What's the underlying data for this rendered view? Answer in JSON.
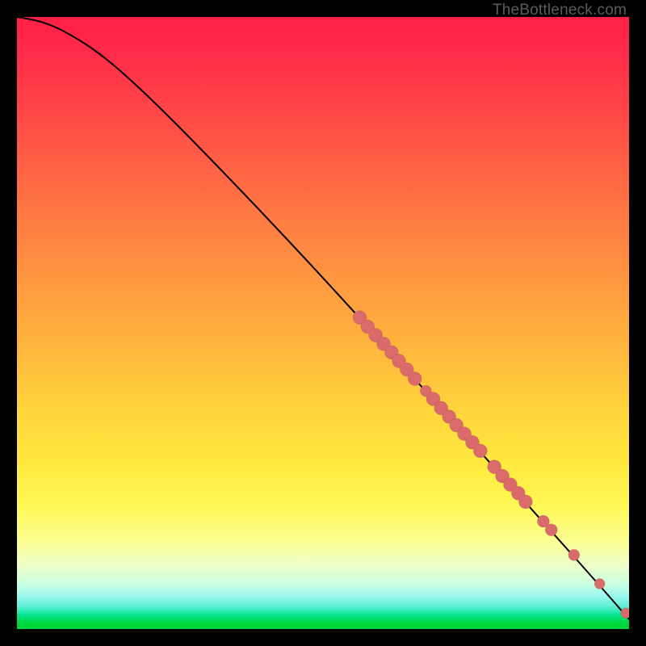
{
  "watermark": "TheBottleneck.com",
  "chart_data": {
    "type": "line",
    "title": "",
    "xlabel": "",
    "ylabel": "",
    "xlim": [
      0,
      100
    ],
    "ylim": [
      0,
      100
    ],
    "grid": false,
    "legend": false,
    "background_gradient": {
      "stops": [
        {
          "pos": 0.0,
          "color": "#ff1f45"
        },
        {
          "pos": 0.14,
          "color": "#ff4247"
        },
        {
          "pos": 0.31,
          "color": "#ff7543"
        },
        {
          "pos": 0.49,
          "color": "#ffa83f"
        },
        {
          "pos": 0.66,
          "color": "#ffd93c"
        },
        {
          "pos": 0.8,
          "color": "#fff856"
        },
        {
          "pos": 0.9,
          "color": "#eeffc8"
        },
        {
          "pos": 0.96,
          "color": "#5ef0d8"
        },
        {
          "pos": 1.0,
          "color": "#00d438"
        }
      ]
    },
    "series": [
      {
        "name": "curve",
        "kind": "line",
        "x": [
          0,
          4,
          8,
          14,
          22,
          34,
          48,
          62,
          76,
          88,
          96,
          100
        ],
        "y": [
          100,
          99.3,
          97.6,
          93.8,
          86.6,
          74.4,
          59.6,
          44.2,
          28.6,
          15.2,
          6.2,
          1.6
        ]
      },
      {
        "name": "points",
        "kind": "scatter",
        "x": [
          56,
          57.3,
          58.6,
          59.9,
          61.2,
          62.4,
          63.7,
          65.0,
          66.8,
          68.0,
          69.3,
          70.6,
          71.8,
          73.1,
          74.4,
          75.7,
          78.0,
          79.3,
          80.6,
          81.9,
          83.1,
          86.0,
          87.3,
          91.0,
          95.2,
          99.5
        ],
        "y": [
          50.9,
          49.4,
          48.0,
          46.6,
          45.2,
          43.8,
          42.4,
          40.9,
          38.9,
          37.6,
          36.1,
          34.7,
          33.3,
          31.9,
          30.5,
          29.1,
          26.5,
          25.0,
          23.6,
          22.2,
          20.8,
          17.6,
          16.2,
          12.1,
          7.4,
          2.6
        ],
        "r": [
          8.5,
          8.5,
          8.5,
          8.5,
          8.5,
          8.5,
          8.5,
          8.5,
          7.0,
          8.5,
          8.5,
          8.5,
          8.5,
          8.5,
          8.5,
          8.5,
          8.5,
          8.5,
          8.5,
          8.5,
          8.5,
          7.5,
          7.5,
          7.0,
          6.5,
          6.5
        ]
      }
    ]
  }
}
